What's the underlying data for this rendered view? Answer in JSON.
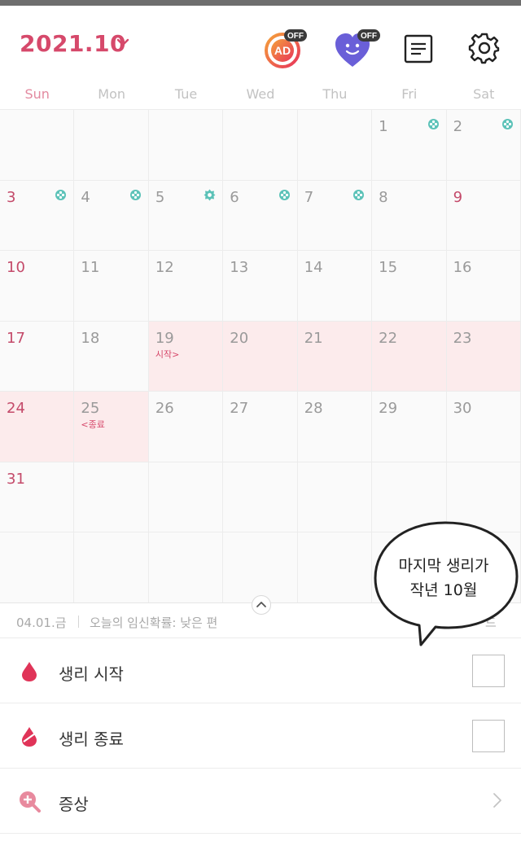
{
  "header": {
    "month": "2021.10",
    "ad_badge": "AD",
    "ad_toggle": "OFF",
    "heart_toggle": "OFF"
  },
  "weekdays": [
    "Sun",
    "Mon",
    "Tue",
    "Wed",
    "Thu",
    "Fri",
    "Sat"
  ],
  "calendar": {
    "rows": [
      [
        {
          "d": ""
        },
        {
          "d": ""
        },
        {
          "d": ""
        },
        {
          "d": ""
        },
        {
          "d": ""
        },
        {
          "d": "1",
          "mark": "flower-icon"
        },
        {
          "d": "2",
          "mark": "flower-icon"
        }
      ],
      [
        {
          "d": "3",
          "mark": "flower-icon"
        },
        {
          "d": "4",
          "mark": "flower-icon"
        },
        {
          "d": "5",
          "mark": "gear-flower-icon"
        },
        {
          "d": "6",
          "mark": "flower-icon"
        },
        {
          "d": "7",
          "mark": "flower-icon"
        },
        {
          "d": "8"
        },
        {
          "d": "9"
        }
      ],
      [
        {
          "d": "10"
        },
        {
          "d": "11"
        },
        {
          "d": "12"
        },
        {
          "d": "13"
        },
        {
          "d": "14"
        },
        {
          "d": "15"
        },
        {
          "d": "16"
        }
      ],
      [
        {
          "d": "17"
        },
        {
          "d": "18"
        },
        {
          "d": "19",
          "tag": "시작>",
          "period": true
        },
        {
          "d": "20",
          "period": true
        },
        {
          "d": "21",
          "period": true
        },
        {
          "d": "22",
          "period": true
        },
        {
          "d": "23",
          "period": true
        }
      ],
      [
        {
          "d": "24",
          "period": true
        },
        {
          "d": "25",
          "tag": "<종료",
          "period": true
        },
        {
          "d": "26"
        },
        {
          "d": "27"
        },
        {
          "d": "28"
        },
        {
          "d": "29"
        },
        {
          "d": "30"
        }
      ],
      [
        {
          "d": "31"
        },
        {
          "d": ""
        },
        {
          "d": ""
        },
        {
          "d": ""
        },
        {
          "d": ""
        },
        {
          "d": ""
        },
        {
          "d": ""
        }
      ],
      [
        {
          "d": ""
        },
        {
          "d": ""
        },
        {
          "d": ""
        },
        {
          "d": ""
        },
        {
          "d": ""
        },
        {
          "d": ""
        },
        {
          "d": ""
        }
      ]
    ],
    "red_saturdays": [
      "9"
    ]
  },
  "info": {
    "date": "04.01.금",
    "text": "오늘의 임신확률: 낮은 편",
    "trail": "드"
  },
  "list": {
    "period_start": "생리 시작",
    "period_end": "생리 종료",
    "symptoms": "증상"
  },
  "bubble": {
    "line1": "마지막 생리가",
    "line2": "작년 10월"
  },
  "colors": {
    "accent": "#d6496b",
    "period_bg": "#fcebec",
    "mark": "#5cc2b8"
  }
}
